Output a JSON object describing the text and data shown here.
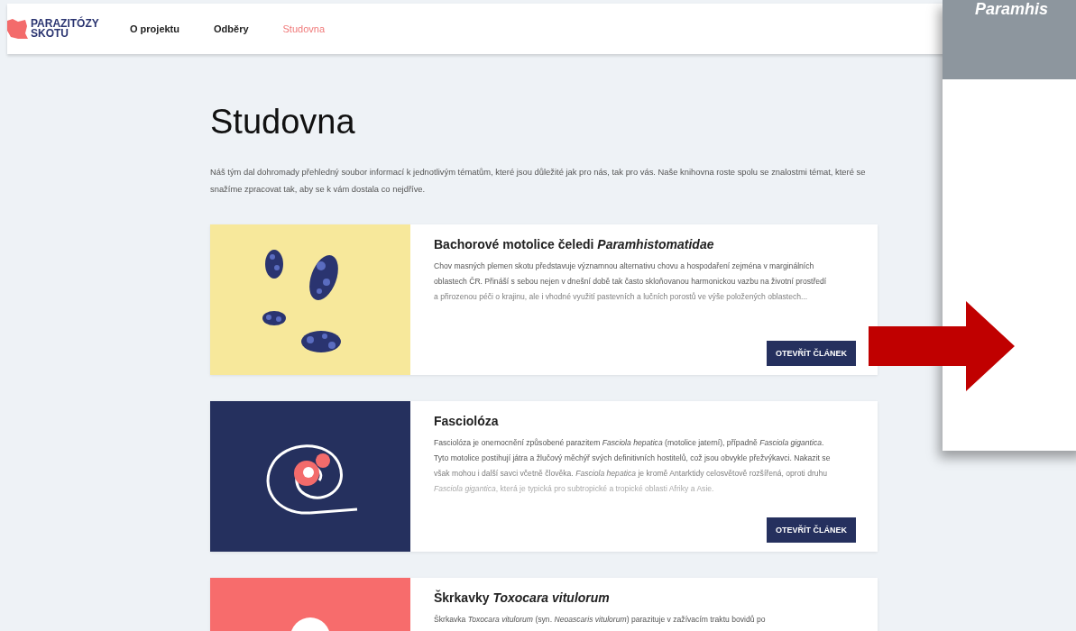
{
  "header": {
    "logo": [
      "PARAZITÓZY",
      "SKOTU"
    ],
    "nav": [
      {
        "label": "O projektu",
        "selected": false
      },
      {
        "label": "Odběry",
        "selected": false
      },
      {
        "label": "Studovna",
        "selected": true
      }
    ]
  },
  "page": {
    "title": "Studovna",
    "intro": "Náš tým dal dohromady přehledný soubor informací k jednotlivým tématům, které jsou důležité jak pro nás, tak pro vás. Naše knihovna roste spolu se znalostmi témat, které se snažíme zpracovat tak, aby se k vám dostala co nejdříve."
  },
  "articles": [
    {
      "kind": "flukes",
      "title": "Bachorové motolice čeledi *Paramhistomatidae*",
      "text": "Chov masných plemen skotu představuje významnou alternativu chovu a hospodaření zejména v marginálních oblastech ČR. Přináší s sebou nejen v dnešní době tak často skloňovanou harmonickou vazbu na životní prostředí a přirozenou péči o krajinu, ale i vhodné využití pastevních a lučních porostů ve výše položených oblastech...",
      "button": "OTEVŘÍT ČLÁNEK"
    },
    {
      "kind": "snail",
      "title": "Fasciolóza",
      "text": "Fasciolóza je onemocnění způsobené parazitem *Fasciola hepatica* (motolice jaterní), případně *Fasciola gigantica*. Tyto motolice postihují játra a žlučový měchýř svých definitivních hostitelů, což jsou obvykle přežvýkavci. Nakazit se však mohou i další savci včetně člověka. *Fasciola hepatica* je kromě Antarktidy celosvětově rozšířená, oproti druhu *Fasciola gigantica*, která je typická pro subtropické a tropické oblasti Afriky a Asie.",
      "button": "OTEVŘÍT ČLÁNEK"
    },
    {
      "kind": "roundworm",
      "title": "Škrkavky *Toxocara vitulorum*",
      "text": "Škrkavka *Toxocara vitulorum* (syn. *Neoascaris vitulorum*) parazituje v zažívacím traktu bovidů po"
    }
  ],
  "overlay": {
    "caption": "Paramhis"
  }
}
